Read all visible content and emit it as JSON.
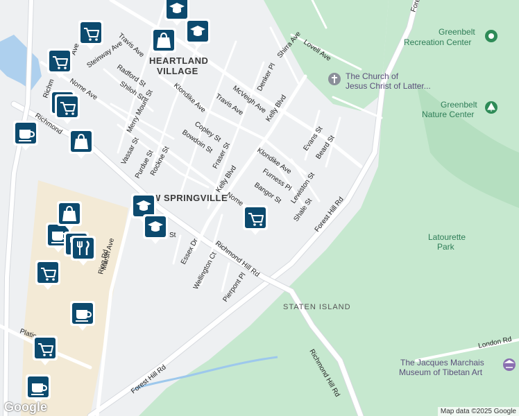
{
  "neighborhoods": {
    "heartland_village": "HEARTLAND VILLAGE",
    "new_springville": "NEW SPRINGVILLE",
    "staten_island": "STATEN ISLAND"
  },
  "parks": {
    "latourette_line1": "Latourette",
    "latourette_line2": "Park",
    "greenbelt_rec_line1": "Greenbelt",
    "greenbelt_rec_line2": "Recreation Center",
    "greenbelt_nature_line1": "Greenbelt",
    "greenbelt_nature_line2": "Nature Center"
  },
  "pois": {
    "church_line1": "The Church of",
    "church_line2": "Jesus Christ of Latter...",
    "museum_line1": "The Jacques Marchais",
    "museum_line2": "Museum of Tibetan Art"
  },
  "streets": {
    "travis_ave_1": "Travis Ave",
    "travis_ave_2": "Travis Ave",
    "steinway_ave": "Steinway Ave",
    "radford_st": "Radford St",
    "shiloh_st": "Shiloh St",
    "nome_ave_1": "Nome Ave",
    "nome_ave_2": "Nome",
    "merry_mount_st": "Merry Mount St",
    "klondike_ave_1": "Klondike Ave",
    "klondike_ave_2": "Klondike Ave",
    "mcveigh_ave": "McVeigh Ave",
    "denker_pl": "Denker Pl",
    "kelly_blvd_1": "Kelly Blvd",
    "kelly_blvd_2": "Kelly Blvd",
    "copley_st": "Copley St",
    "bowdoin_st": "Bowdoin St",
    "fraser_st": "Fraser St",
    "vassar_st": "Vassar St",
    "purdue_st": "Purdue St",
    "rockne_st": "Rockne St",
    "furness_pl": "Furness Pl",
    "bangor_st": "Bangor St",
    "lewiston_st": "Lewiston St",
    "shale_st": "Shale St",
    "evans_st": "Evans St",
    "beard_st": "Beard St",
    "shirra_ave": "Shirra Ave",
    "lovell_ave": "Lovell Ave",
    "forest_hill_rd_1": "Forest Hill Rd",
    "forest_hill_rd_2": "Forest Hill Rd",
    "forest_hill_rd_3": "Forest",
    "richmond_hill_rd_1": "Richmond Hill Rd",
    "richmond_hill_rd_2": "Richmond Hill Rd",
    "richmond_1": "Richmond",
    "richmond_2": "Richm",
    "marsh_ave": "Marsh Ave",
    "ring_rd": "Ring Rd",
    "essex_dr": "Essex Dr",
    "wellington_ct": "Wellington Ct",
    "pierpont_pl": "Pierpont Pl",
    "london_rd": "London Rd",
    "platinum_ave": "Platin",
    "st_fragment": "St",
    "ave_fragment": "Ave"
  },
  "icons": {
    "shopping_cart": "shopping-cart-icon",
    "shopping_bag": "shopping-bag-icon",
    "coffee_cup": "coffee-cup-icon",
    "school": "school-icon",
    "restaurant": "restaurant-icon",
    "church": "church-icon",
    "tree": "tree-icon",
    "recreation": "recreation-icon",
    "museum": "museum-icon"
  },
  "colors": {
    "land": "#eef0f2",
    "park": "#c6e8cf",
    "park_dark": "#b5dfc0",
    "road": "#ffffff",
    "road_edge": "#d6d9de",
    "mall": "#f3ead6",
    "water": "#9dc8ec",
    "marker": "#0c4a6e",
    "marker_border": "#ffffff"
  },
  "attribution": {
    "google_logo": "Google",
    "map_data": "Map data ©2025 Google"
  }
}
